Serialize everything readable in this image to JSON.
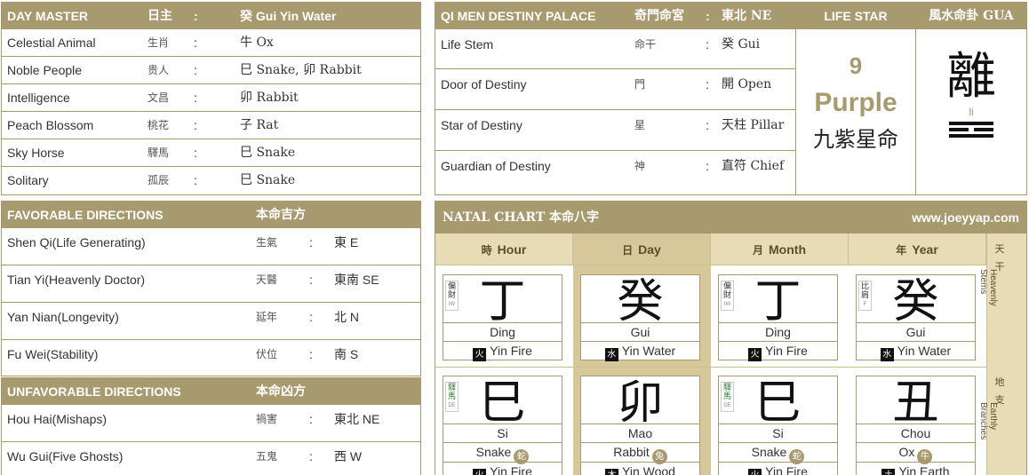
{
  "day_master": {
    "title": "DAY MASTER",
    "title_cn": "日主",
    "colon": ":",
    "value": "癸 Gui Yin Water",
    "rows": [
      {
        "label": "Celestial Animal",
        "cn": "生肖",
        "value": "牛 Ox"
      },
      {
        "label": "Noble People",
        "cn": "贵人",
        "value": "巳 Snake, 卯 Rabbit"
      },
      {
        "label": "Intelligence",
        "cn": "文昌",
        "value": "卯 Rabbit"
      },
      {
        "label": "Peach Blossom",
        "cn": "桃花",
        "value": "子 Rat"
      },
      {
        "label": "Sky Horse",
        "cn": "驛馬",
        "value": "巳 Snake"
      },
      {
        "label": "Solitary",
        "cn": "孤辰",
        "value": "巳 Snake"
      }
    ]
  },
  "favorable": {
    "title": "FAVORABLE DIRECTIONS",
    "title_cn": "本命吉方",
    "rows": [
      {
        "label": "Shen Qi(Life Generating)",
        "cn": "生氣",
        "value": "東 E"
      },
      {
        "label": "Tian Yi(Heavenly Doctor)",
        "cn": "天醫",
        "value": "東南 SE"
      },
      {
        "label": "Yan Nian(Longevity)",
        "cn": "延年",
        "value": "北 N"
      },
      {
        "label": "Fu Wei(Stability)",
        "cn": "伏位",
        "value": "南 S"
      }
    ]
  },
  "unfavorable": {
    "title": "UNFAVORABLE DIRECTIONS",
    "title_cn": "本命凶方",
    "rows": [
      {
        "label": "Hou Hai(Mishaps)",
        "cn": "禍害",
        "value": "東北 NE"
      },
      {
        "label": "Wu Gui(Five Ghosts)",
        "cn": "五鬼",
        "value": "西 W"
      }
    ]
  },
  "qimen": {
    "title": "QI MEN DESTINY PALACE",
    "title_cn": "奇門命宮",
    "value": "東北 NE",
    "rows": [
      {
        "label": "Life Stem",
        "cn": "命干",
        "value": "癸 Gui"
      },
      {
        "label": "Door of Destiny",
        "cn": "門",
        "value": "開 Open"
      },
      {
        "label": "Star of Destiny",
        "cn": "星",
        "value": "天柱 Pillar"
      },
      {
        "label": "Guardian of Destiny",
        "cn": "神",
        "value": "直符 Chief"
      }
    ]
  },
  "life_star": {
    "title": "LIFE STAR",
    "number": "9",
    "name": "Purple",
    "cn": "九紫星命"
  },
  "gua": {
    "title": "風水命卦 GUA",
    "char": "離",
    "pinyin": "li"
  },
  "natal": {
    "title": "NATAL CHART 本命八字",
    "site": "www.joeyyap.com",
    "columns": [
      {
        "cn": "時",
        "label": "Hour"
      },
      {
        "cn": "日",
        "label": "Day"
      },
      {
        "cn": "月",
        "label": "Month"
      },
      {
        "cn": "年",
        "label": "Year"
      }
    ],
    "stems": [
      {
        "char": "丁",
        "tag": "偏財",
        "abbr": "IW",
        "pinyin": "Ding",
        "el_cn": "火",
        "element": "Yin Fire"
      },
      {
        "char": "癸",
        "tag": "",
        "abbr": "",
        "pinyin": "Gui",
        "el_cn": "水",
        "element": "Yin Water"
      },
      {
        "char": "丁",
        "tag": "偏財",
        "abbr": "IW",
        "pinyin": "Ding",
        "el_cn": "火",
        "element": "Yin Fire"
      },
      {
        "char": "癸",
        "tag": "比肩",
        "abbr": "F",
        "pinyin": "Gui",
        "el_cn": "水",
        "element": "Yin Water"
      }
    ],
    "branches": [
      {
        "char": "巳",
        "tag": "驛馬",
        "abbr": "DE",
        "pinyin": "Si",
        "animal": "Snake",
        "an_cn": "蛇",
        "el_cn": "火",
        "element": "Yin Fire"
      },
      {
        "char": "卯",
        "tag": "",
        "abbr": "",
        "pinyin": "Mao",
        "animal": "Rabbit",
        "an_cn": "兔",
        "el_cn": "木",
        "element": "Yin Wood"
      },
      {
        "char": "巳",
        "tag": "驛馬",
        "abbr": "DE",
        "pinyin": "Si",
        "animal": "Snake",
        "an_cn": "蛇",
        "el_cn": "火",
        "element": "Yin Fire"
      },
      {
        "char": "丑",
        "tag": "",
        "abbr": "",
        "pinyin": "Chou",
        "animal": "Ox",
        "an_cn": "牛",
        "el_cn": "土",
        "element": "Yin Earth"
      }
    ],
    "side_stems": {
      "cn": "天干",
      "en": "Heavenly Stems"
    },
    "side_branches": {
      "cn": "地支",
      "en": "Earthly Branches"
    }
  },
  "colors": {
    "accent": "#a89a6f",
    "highlight": "#d7c899",
    "header_light": "#e7dcb6"
  }
}
